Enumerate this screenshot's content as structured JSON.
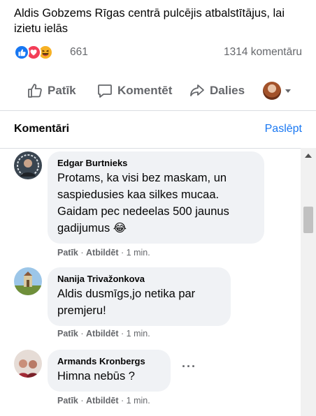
{
  "post": {
    "text": "Aldis Gobzems Rīgas centrā pulcējis atbalstītājus, lai izietu ielās",
    "reaction_count": "661",
    "comment_count": "1314 komentāru"
  },
  "actions": {
    "like": "Patīk",
    "comment": "Komentēt",
    "share": "Dalies"
  },
  "comments_section": {
    "title": "Komentāri",
    "hide_label": "Paslēpt"
  },
  "comments": [
    {
      "author": "Edgar Burtnieks",
      "text": "Protams, ka visi bez maskam, un saspiedusies kaa silkes mucaa. Gaidam pec nedeelas 500 jaunus gadijumus 😂",
      "like": "Patīk",
      "sep1": " · ",
      "reply": "Atbildēt",
      "sep2": " · ",
      "time": "1 min."
    },
    {
      "author": "Nanija Trivažonkova",
      "text": "Aldis dusmīgs,jo netika par premjeru!",
      "like": "Patīk",
      "sep1": " · ",
      "reply": "Atbildēt",
      "sep2": " · ",
      "time": "1 min."
    },
    {
      "author": "Armands Kronbergs",
      "text": "Himna nebūs ?",
      "like": "Patīk",
      "sep1": " · ",
      "reply": "Atbildēt",
      "sep2": " · ",
      "time": "1 min."
    }
  ],
  "icons": {
    "like_reaction": "like-reaction-icon",
    "love_reaction": "love-reaction-icon",
    "haha_reaction": "haha-reaction-icon",
    "like_action": "thumbs-up-icon",
    "comment_action": "comment-bubble-icon",
    "share_action": "share-arrow-icon",
    "audience_caret": "chevron-down-icon",
    "more_options": "more-options-icon"
  },
  "colors": {
    "accent": "#1877f2",
    "secondary_text": "#65676b",
    "bubble": "#f0f2f5"
  }
}
